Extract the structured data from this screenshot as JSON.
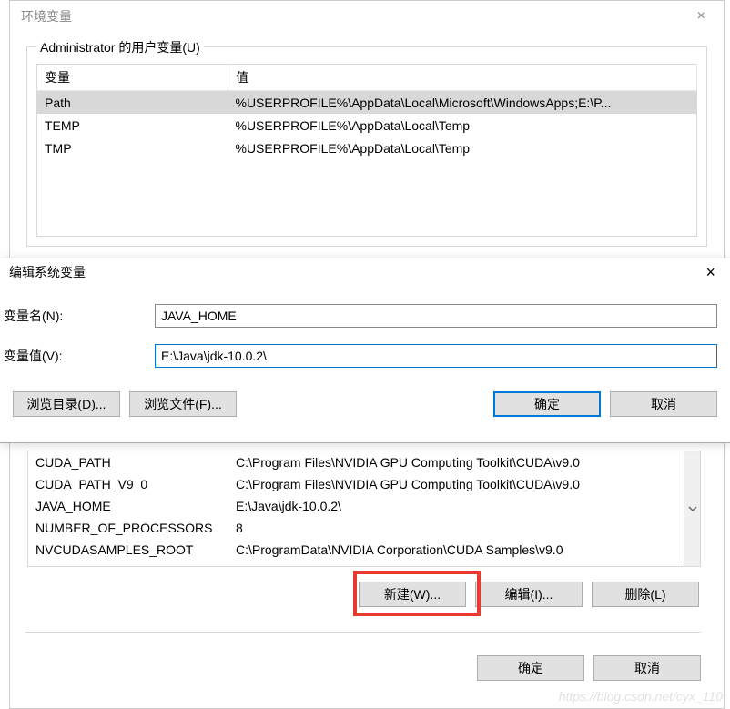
{
  "outer": {
    "title": "环境变量",
    "close": "×"
  },
  "user_vars": {
    "legend": "Administrator 的用户变量(U)",
    "headers": {
      "name": "变量",
      "value": "值"
    },
    "rows": [
      {
        "name": "Path",
        "value": "%USERPROFILE%\\AppData\\Local\\Microsoft\\WindowsApps;E:\\P..."
      },
      {
        "name": "TEMP",
        "value": "%USERPROFILE%\\AppData\\Local\\Temp"
      },
      {
        "name": "TMP",
        "value": "%USERPROFILE%\\AppData\\Local\\Temp"
      }
    ]
  },
  "edit_dialog": {
    "title": "编辑系统变量",
    "close": "×",
    "name_label": "变量名(N):",
    "value_label": "变量值(V):",
    "name_value": "JAVA_HOME",
    "value_value": "E:\\Java\\jdk-10.0.2\\",
    "browse_dir": "浏览目录(D)...",
    "browse_file": "浏览文件(F)...",
    "ok": "确定",
    "cancel": "取消"
  },
  "sys_vars": {
    "rows": [
      {
        "name": "CUDA_PATH",
        "value": "C:\\Program Files\\NVIDIA GPU Computing Toolkit\\CUDA\\v9.0"
      },
      {
        "name": "CUDA_PATH_V9_0",
        "value": "C:\\Program Files\\NVIDIA GPU Computing Toolkit\\CUDA\\v9.0"
      },
      {
        "name": "JAVA_HOME",
        "value": "E:\\Java\\jdk-10.0.2\\"
      },
      {
        "name": "NUMBER_OF_PROCESSORS",
        "value": "8"
      },
      {
        "name": "NVCUDASAMPLES_ROOT",
        "value": "C:\\ProgramData\\NVIDIA Corporation\\CUDA Samples\\v9.0"
      }
    ],
    "new_btn": "新建(W)...",
    "edit_btn": "编辑(I)...",
    "delete_btn": "删除(L)"
  },
  "final": {
    "ok": "确定",
    "cancel": "取消"
  },
  "watermark": "https://blog.csdn.net/cyx_110"
}
